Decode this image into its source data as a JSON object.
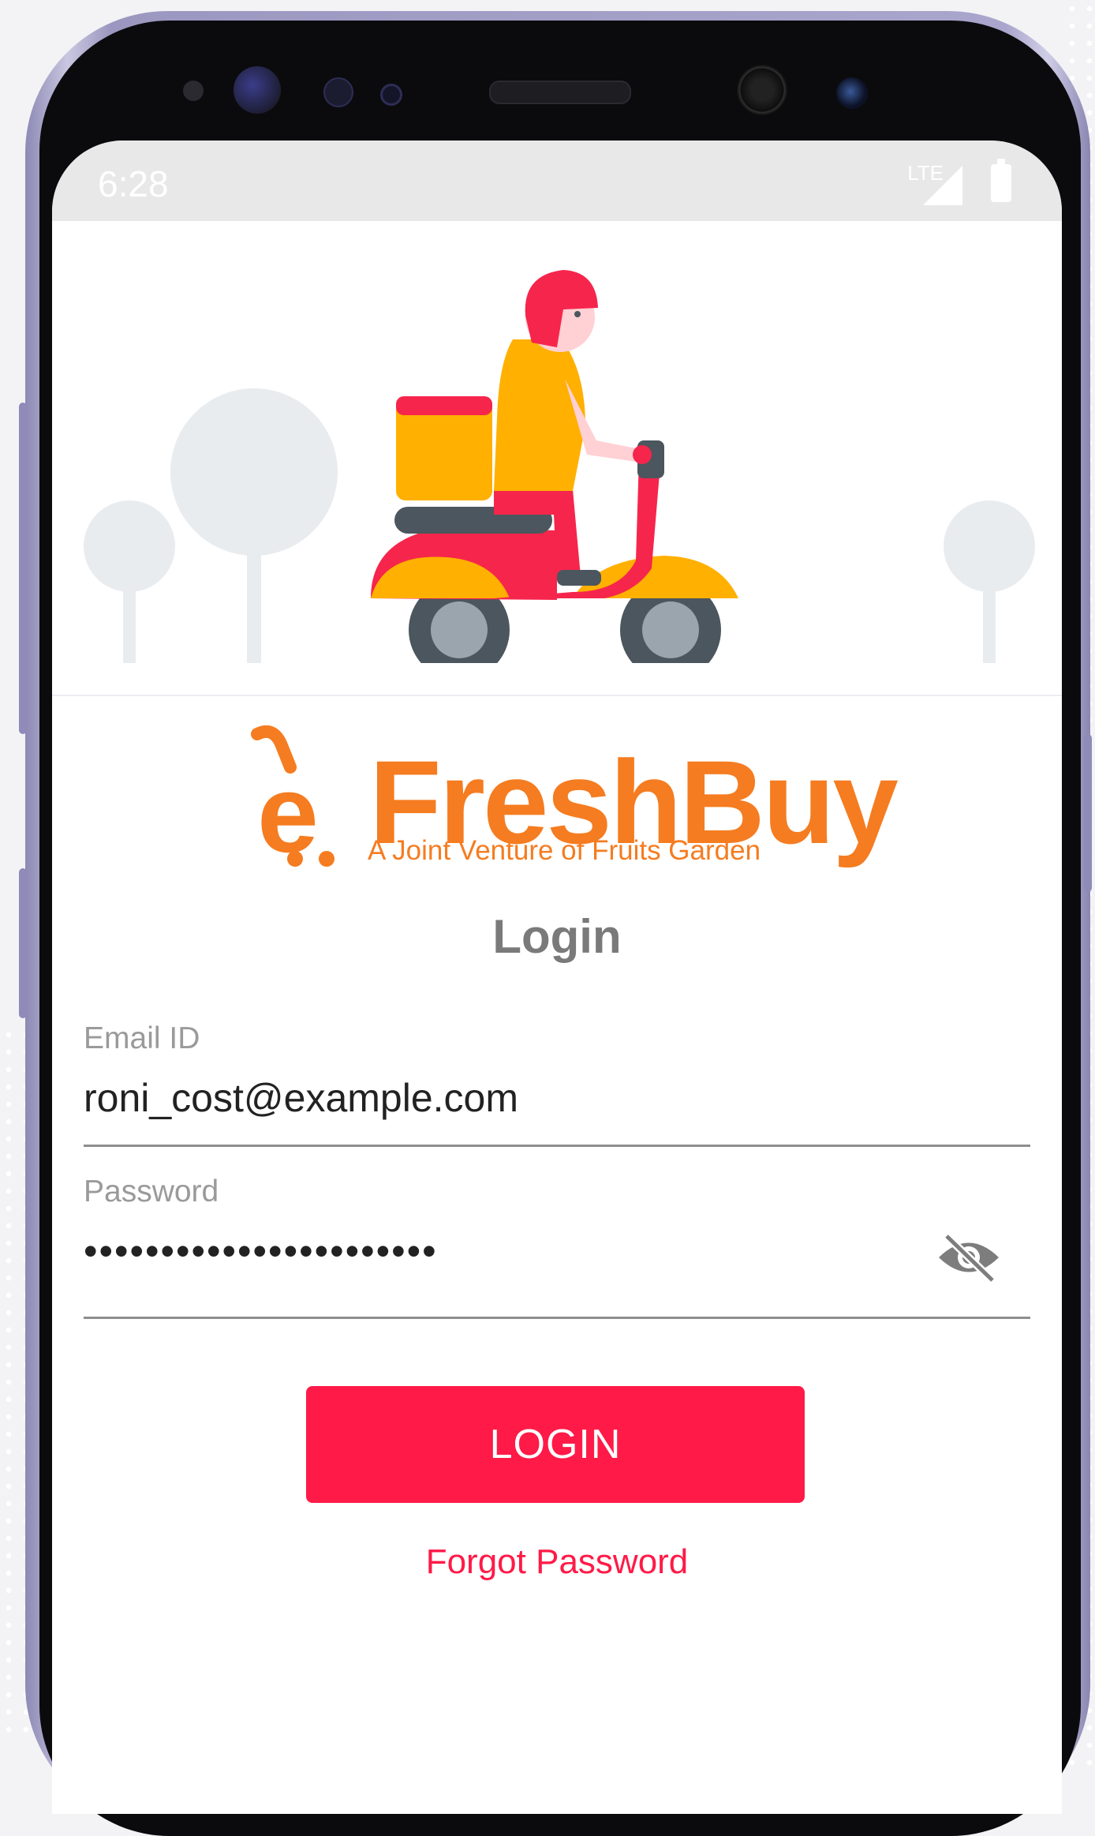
{
  "statusbar": {
    "time": "6:28",
    "network": "LTE"
  },
  "logo": {
    "mark": "e",
    "brand": "FreshBuy",
    "tagline": "A Joint Venture of Fruits Garden"
  },
  "page": {
    "title": "Login"
  },
  "form": {
    "email_label": "Email ID",
    "email_value": "roni_cost@example.com",
    "password_label": "Password",
    "password_masked": "•••••••••••••••••••••••",
    "login_label": "LOGIN",
    "forgot_label": "Forgot Password"
  },
  "icons": {
    "password_toggle": "eye-off-icon",
    "hero": "delivery-scooter-illustration",
    "signal": "signal-icon",
    "battery": "battery-icon"
  },
  "colors": {
    "accent": "#ff1a47",
    "brand": "#f57c20",
    "scooter_red": "#f6254c",
    "scooter_yellow": "#ffb000",
    "tree": "#e9ecef"
  }
}
